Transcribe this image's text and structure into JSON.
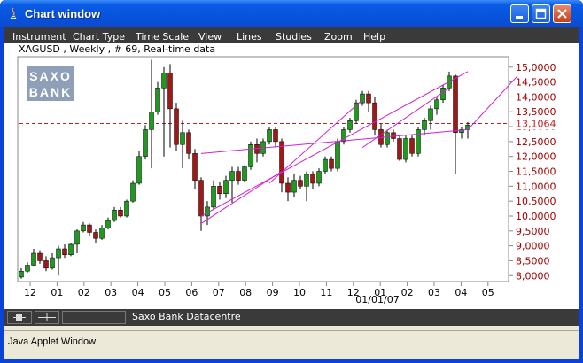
{
  "window": {
    "title": "Chart window"
  },
  "menu": {
    "items": [
      "Instrument",
      "Chart Type",
      "Time Scale",
      "View",
      "Lines",
      "Studies",
      "Zoom",
      "Help"
    ]
  },
  "chart": {
    "header": "XAGUSD , Weekly , # 69, Real-time data",
    "logo_line1": "SAXO",
    "logo_line2": "BANK",
    "current_price_label": "13,1064",
    "year_label": "01/01/07"
  },
  "status": {
    "datacentre": "Saxo Bank Datacentre"
  },
  "applet": {
    "label": "Java Applet Window"
  },
  "colors": {
    "bull": "#1e9a1e",
    "bear": "#a01818",
    "channel": "#d020d0",
    "price_line": "#c02020",
    "axis_text": "#a00000"
  },
  "chart_data": {
    "type": "candlestick",
    "ylim": [
      7.8,
      15.35
    ],
    "price_line": 13.1064,
    "y_ticks": [
      8,
      8.5,
      9,
      9.5,
      10,
      10.5,
      11,
      11.5,
      12,
      12.5,
      13,
      13.5,
      14,
      14.5,
      15
    ],
    "y_tick_labels": [
      "8,0000",
      "8,5000",
      "9,0000",
      "9,5000",
      "10,0000",
      "10,5000",
      "11,0000",
      "11,5000",
      "12,0000",
      "12,5000",
      "13,0000",
      "13,5000",
      "14,0000",
      "14,5000",
      "15,0000"
    ],
    "x_tick_labels": [
      "12",
      "01",
      "02",
      "03",
      "04",
      "05",
      "06",
      "07",
      "08",
      "09",
      "10",
      "11",
      "12",
      "01",
      "02",
      "03",
      "04",
      "05"
    ],
    "candles": [
      [
        7.95,
        8.15,
        7.9,
        8.25
      ],
      [
        8.15,
        8.35,
        8.1,
        8.45
      ],
      [
        8.35,
        8.75,
        8.3,
        8.9
      ],
      [
        8.75,
        8.5,
        8.4,
        8.85
      ],
      [
        8.5,
        8.25,
        8.15,
        8.65
      ],
      [
        8.25,
        8.6,
        8.2,
        8.75
      ],
      [
        8.6,
        8.9,
        8.0,
        9.0
      ],
      [
        8.9,
        8.7,
        8.6,
        9.05
      ],
      [
        8.7,
        9.05,
        8.65,
        9.1
      ],
      [
        9.05,
        9.5,
        8.75,
        9.55
      ],
      [
        9.5,
        9.7,
        9.45,
        9.8
      ],
      [
        9.7,
        9.45,
        9.35,
        9.75
      ],
      [
        9.45,
        9.25,
        9.1,
        9.55
      ],
      [
        9.25,
        9.6,
        9.2,
        9.7
      ],
      [
        9.6,
        9.85,
        9.55,
        9.95
      ],
      [
        9.85,
        10.2,
        9.8,
        10.3
      ],
      [
        10.2,
        10.0,
        9.95,
        10.3
      ],
      [
        10.0,
        10.5,
        9.95,
        10.55
      ],
      [
        10.5,
        11.1,
        10.45,
        11.2
      ],
      [
        11.1,
        12.0,
        11.05,
        12.2
      ],
      [
        12.0,
        12.9,
        11.9,
        13.05
      ],
      [
        12.9,
        13.5,
        11.6,
        15.25
      ],
      [
        13.5,
        14.3,
        13.4,
        14.5
      ],
      [
        14.3,
        14.8,
        12.0,
        15.0
      ],
      [
        14.8,
        13.6,
        12.3,
        15.1
      ],
      [
        13.6,
        12.4,
        12.2,
        13.8
      ],
      [
        12.4,
        12.8,
        11.6,
        13.2
      ],
      [
        12.8,
        12.1,
        11.9,
        12.9
      ],
      [
        12.1,
        11.2,
        10.9,
        12.25
      ],
      [
        11.2,
        10.0,
        9.5,
        11.3
      ],
      [
        10.0,
        10.3,
        9.7,
        10.5
      ],
      [
        10.3,
        11.0,
        10.2,
        11.2
      ],
      [
        11.0,
        10.75,
        10.55,
        11.15
      ],
      [
        10.75,
        11.2,
        10.6,
        11.35
      ],
      [
        11.2,
        11.5,
        10.45,
        11.65
      ],
      [
        11.5,
        11.2,
        11.05,
        11.65
      ],
      [
        11.2,
        11.65,
        11.15,
        11.7
      ],
      [
        11.65,
        12.4,
        11.55,
        12.5
      ],
      [
        12.4,
        12.1,
        11.8,
        12.6
      ],
      [
        12.1,
        12.5,
        12.0,
        12.6
      ],
      [
        12.5,
        12.9,
        12.4,
        13.0
      ],
      [
        12.9,
        12.5,
        12.3,
        13.0
      ],
      [
        12.5,
        11.1,
        10.8,
        12.6
      ],
      [
        11.1,
        10.8,
        10.5,
        11.3
      ],
      [
        10.8,
        11.2,
        10.65,
        11.4
      ],
      [
        11.2,
        11.0,
        10.9,
        11.35
      ],
      [
        11.0,
        11.4,
        10.5,
        11.5
      ],
      [
        11.4,
        11.1,
        10.9,
        11.5
      ],
      [
        11.1,
        11.5,
        11.0,
        11.6
      ],
      [
        11.5,
        11.9,
        11.4,
        12.0
      ],
      [
        11.9,
        11.6,
        11.5,
        12.0
      ],
      [
        11.6,
        12.5,
        11.5,
        12.6
      ],
      [
        12.5,
        12.9,
        12.4,
        13.0
      ],
      [
        12.9,
        13.2,
        12.8,
        13.3
      ],
      [
        13.2,
        13.8,
        13.1,
        13.9
      ],
      [
        13.8,
        14.1,
        13.7,
        14.2
      ],
      [
        14.1,
        13.8,
        13.5,
        14.2
      ],
      [
        13.8,
        12.9,
        12.7,
        14.0
      ],
      [
        12.9,
        12.4,
        12.3,
        13.1
      ],
      [
        12.4,
        12.8,
        12.3,
        12.9
      ],
      [
        12.8,
        12.6,
        12.5,
        12.9
      ],
      [
        12.6,
        11.9,
        11.85,
        12.7
      ],
      [
        11.9,
        12.6,
        11.8,
        12.7
      ],
      [
        12.6,
        12.1,
        12.0,
        12.7
      ],
      [
        12.1,
        12.9,
        12.0,
        13.0
      ],
      [
        12.9,
        13.2,
        12.7,
        13.3
      ],
      [
        13.2,
        13.6,
        12.9,
        13.7
      ],
      [
        13.6,
        13.9,
        13.4,
        14.0
      ],
      [
        13.9,
        14.3,
        13.8,
        14.4
      ],
      [
        14.3,
        14.7,
        14.2,
        14.85
      ],
      [
        14.7,
        12.8,
        11.4,
        14.75
      ],
      [
        12.8,
        12.9,
        12.6,
        13.0
      ],
      [
        12.9,
        13.05,
        12.6,
        13.15
      ]
    ]
  }
}
